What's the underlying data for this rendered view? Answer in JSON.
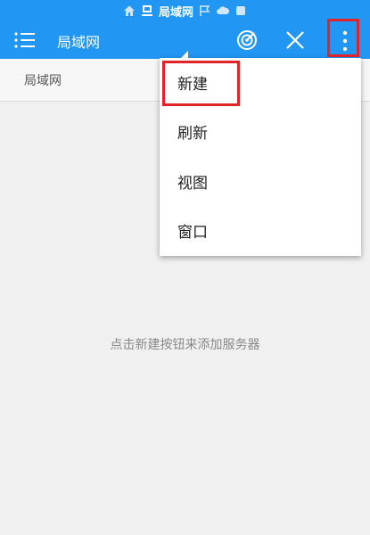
{
  "status_bar": {
    "title": "局域网",
    "icons": [
      "home-icon",
      "network-drive-icon",
      "flag-icon",
      "cloud-icon",
      "square-icon"
    ]
  },
  "toolbar": {
    "title": "局域网",
    "icons": [
      "hamburger-menu-icon",
      "dropdown-caret-icon",
      "radar-icon",
      "close-icon",
      "more-vertical-icon"
    ]
  },
  "breadcrumb": {
    "path": "局域网"
  },
  "menu": {
    "items": [
      {
        "label": "新建"
      },
      {
        "label": "刷新"
      },
      {
        "label": "视图"
      },
      {
        "label": "窗口"
      }
    ]
  },
  "empty_state": {
    "message": "点击新建按钮来添加服务器"
  },
  "colors": {
    "accent": "#2196f3",
    "highlight": "#e0252a",
    "background": "#f0f0f0"
  }
}
